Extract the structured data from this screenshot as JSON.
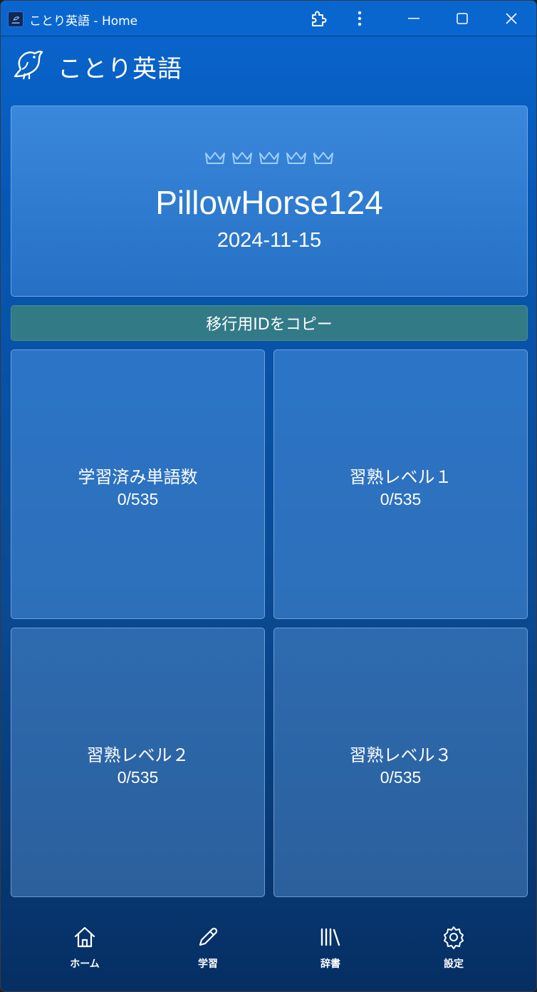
{
  "window": {
    "title": "ことり英語 - Home"
  },
  "header": {
    "title": "ことり英語"
  },
  "profile": {
    "crowns": [
      "crown-icon",
      "crown-icon",
      "crown-icon",
      "crown-icon",
      "crown-icon"
    ],
    "username": "PillowHorse124",
    "date": "2024-11-15"
  },
  "copy_button": {
    "label": "移行用IDをコピー"
  },
  "stats": [
    {
      "label": "学習済み単語数",
      "value": "0/535"
    },
    {
      "label": "習熟レベル１",
      "value": "0/535"
    },
    {
      "label": "習熟レベル２",
      "value": "0/535"
    },
    {
      "label": "習熟レベル３",
      "value": "0/535"
    }
  ],
  "nav": [
    {
      "label": "ホーム",
      "icon": "home-icon"
    },
    {
      "label": "学習",
      "icon": "pencil-icon"
    },
    {
      "label": "辞書",
      "icon": "library-icon"
    },
    {
      "label": "設定",
      "icon": "gear-icon"
    }
  ],
  "colors": {
    "accent": "#0a66cf",
    "copy_button": "#337a87",
    "text": "#ffffff"
  }
}
